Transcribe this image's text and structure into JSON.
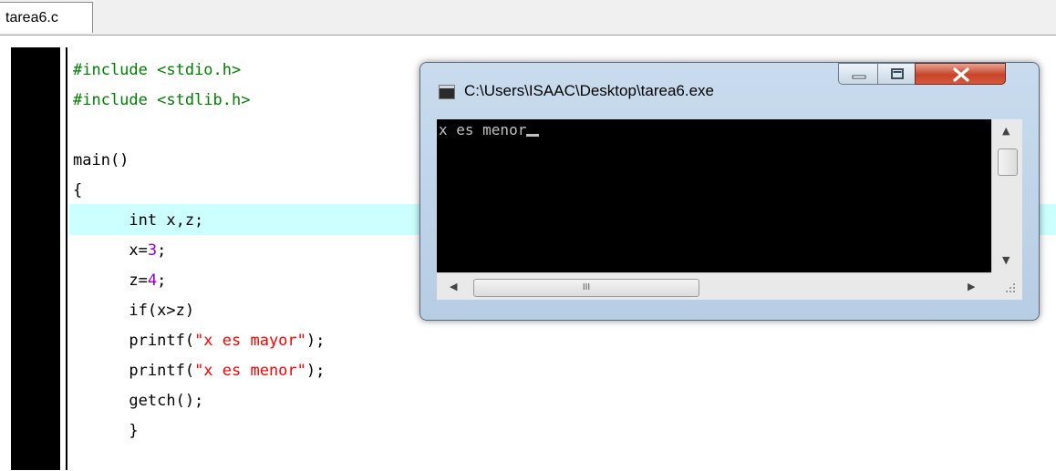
{
  "editor": {
    "tab_label": "tarea6.c",
    "lines": [
      {
        "parts": [
          {
            "t": "#include <stdio.h>",
            "c": "green"
          }
        ]
      },
      {
        "parts": [
          {
            "t": "#include <stdlib.h>",
            "c": "green"
          }
        ]
      },
      {
        "parts": [
          {
            "t": "",
            "c": "black"
          }
        ]
      },
      {
        "parts": [
          {
            "t": "main()",
            "c": "black"
          }
        ]
      },
      {
        "parts": [
          {
            "t": "{",
            "c": "black"
          }
        ]
      },
      {
        "parts": [
          {
            "t": "      int x,z;",
            "c": "black"
          }
        ]
      },
      {
        "parts": [
          {
            "t": "      x=",
            "c": "black"
          },
          {
            "t": "3",
            "c": "purple"
          },
          {
            "t": ";",
            "c": "black"
          }
        ]
      },
      {
        "parts": [
          {
            "t": "      z=",
            "c": "black"
          },
          {
            "t": "4",
            "c": "purple"
          },
          {
            "t": ";",
            "c": "black"
          }
        ]
      },
      {
        "parts": [
          {
            "t": "      if(x>z)",
            "c": "black"
          }
        ]
      },
      {
        "parts": [
          {
            "t": "      printf(",
            "c": "black"
          },
          {
            "t": "\"x es mayor\"",
            "c": "red"
          },
          {
            "t": ");",
            "c": "black"
          }
        ]
      },
      {
        "parts": [
          {
            "t": "      printf(",
            "c": "black"
          },
          {
            "t": "\"x es menor\"",
            "c": "red"
          },
          {
            "t": ");",
            "c": "black"
          }
        ]
      },
      {
        "parts": [
          {
            "t": "      getch();",
            "c": "black"
          }
        ]
      },
      {
        "parts": [
          {
            "t": "      }",
            "c": "black"
          }
        ]
      }
    ],
    "highlighted_line": 6
  },
  "console_window": {
    "title": "C:\\Users\\ISAAC\\Desktop\\tarea6.exe",
    "output": "x es menor",
    "scroll_thumb_label": "III"
  },
  "colors": {
    "keyword_green": "#008000",
    "number_purple": "#9400d3",
    "string_red": "#ff0000",
    "current_line_bg": "#ccffff",
    "close_button": "#c7442a"
  }
}
